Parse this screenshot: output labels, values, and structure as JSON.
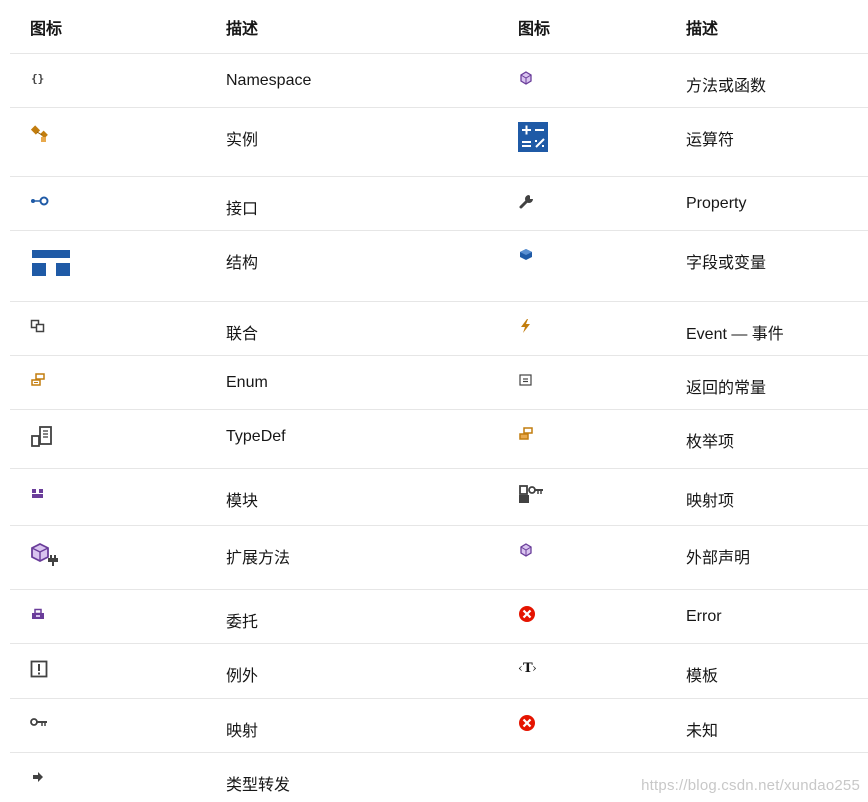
{
  "header": {
    "icon_col_1": "图标",
    "desc_col_1": "描述",
    "icon_col_2": "图标",
    "desc_col_2": "描述"
  },
  "rows": [
    {
      "left": {
        "icon": "namespace-icon",
        "label": "Namespace"
      },
      "right": {
        "icon": "method-icon",
        "label": "方法或函数"
      }
    },
    {
      "left": {
        "icon": "instance-icon",
        "label": "实例"
      },
      "right": {
        "icon": "operator-icon",
        "label": "运算符"
      }
    },
    {
      "left": {
        "icon": "interface-icon",
        "label": "接口"
      },
      "right": {
        "icon": "property-icon",
        "label": "Property"
      }
    },
    {
      "left": {
        "icon": "struct-icon",
        "label": "结构"
      },
      "right": {
        "icon": "field-icon",
        "label": "字段或变量"
      }
    },
    {
      "left": {
        "icon": "union-icon",
        "label": "联合"
      },
      "right": {
        "icon": "event-icon",
        "label": "Event — 事件"
      }
    },
    {
      "left": {
        "icon": "enum-icon",
        "label": "Enum"
      },
      "right": {
        "icon": "constant-icon",
        "label": "返回的常量"
      }
    },
    {
      "left": {
        "icon": "typedef-icon",
        "label": "TypeDef"
      },
      "right": {
        "icon": "enum-item-icon",
        "label": "枚举项"
      }
    },
    {
      "left": {
        "icon": "module-icon",
        "label": "模块"
      },
      "right": {
        "icon": "map-item-icon",
        "label": "映射项"
      }
    },
    {
      "left": {
        "icon": "extension-method-icon",
        "label": "扩展方法"
      },
      "right": {
        "icon": "external-declaration-icon",
        "label": "外部声明"
      }
    },
    {
      "left": {
        "icon": "delegate-icon",
        "label": "委托"
      },
      "right": {
        "icon": "error-icon",
        "label": "Error"
      }
    },
    {
      "left": {
        "icon": "exception-icon",
        "label": "例外"
      },
      "right": {
        "icon": "template-icon",
        "label": "模板"
      }
    },
    {
      "left": {
        "icon": "map-icon",
        "label": "映射"
      },
      "right": {
        "icon": "unknown-icon",
        "label": "未知"
      }
    },
    {
      "left": {
        "icon": "type-forwarding-icon",
        "label": "类型转发"
      }
    }
  ],
  "watermark": "https://blog.csdn.net/xundao255",
  "colors": {
    "border": "#e6e6e6",
    "purple": "#6a3d9a",
    "orange": "#c27d0e",
    "blue": "#1f5aa6",
    "red": "#e51400",
    "dark": "#424242"
  }
}
